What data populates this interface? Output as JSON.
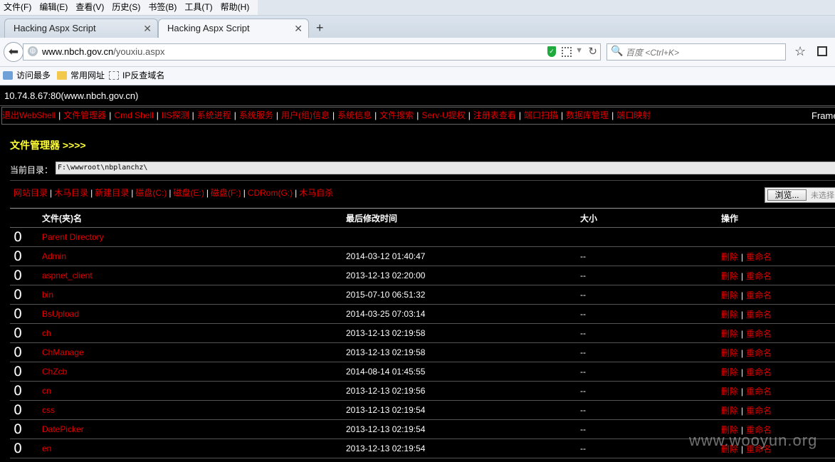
{
  "menu_bar": {
    "items": [
      "文件(F)",
      "编辑(E)",
      "查看(V)",
      "历史(S)",
      "书签(B)",
      "工具(T)",
      "帮助(H)"
    ]
  },
  "tabs": [
    {
      "label": "Hacking Aspx Script",
      "active": false
    },
    {
      "label": "Hacking Aspx Script",
      "active": true
    }
  ],
  "new_tab_label": "+",
  "nav": {
    "url_domain": "www.nbch.gov.cn",
    "url_path": "/youxiu.aspx",
    "search_placeholder": "百度 <Ctrl+K>"
  },
  "bookmarks": [
    "访问最多",
    "常用网址",
    "IP反查域名"
  ],
  "page": {
    "host": "10.74.8.67:80(www.nbch.gov.cn)",
    "top_menu": [
      "退出WebShell",
      "文件管理器",
      "Cmd Shell",
      "IIS探测",
      "系统进程",
      "系统服务",
      "用户(组)信息",
      "系统信息",
      "文件搜索",
      "Serv-U提权",
      "注册表查看",
      "端口扫描",
      "数据库管理",
      "端口映射"
    ],
    "frame_label": "Frame",
    "title": "文件管理器 >>>>",
    "current_dir_label": "当前目录：",
    "current_dir": "F:\\wwwroot\\nbplanchz\\",
    "dir_links": [
      "网站目录",
      "木马目录",
      "新建目录",
      "磁盘(C:)",
      "磁盘(E:)",
      "磁盘(F:)",
      "CDRom(G:)",
      "木马自杀"
    ],
    "browse_button": "浏览...",
    "no_file_text": "未选择",
    "table": {
      "headers": [
        "文件(夹)名",
        "最后修改时间",
        "大小",
        "操作"
      ],
      "rows": [
        {
          "icon": "0",
          "name": "Parent Directory",
          "modified": "",
          "size": "",
          "delete": "",
          "rename": ""
        },
        {
          "icon": "0",
          "name": "Admin",
          "modified": "2014-03-12 01:40:47",
          "size": "--",
          "delete": "删除",
          "rename": "重命名"
        },
        {
          "icon": "0",
          "name": "aspnet_client",
          "modified": "2013-12-13 02:20:00",
          "size": "--",
          "delete": "删除",
          "rename": "重命名"
        },
        {
          "icon": "0",
          "name": "bin",
          "modified": "2015-07-10 06:51:32",
          "size": "--",
          "delete": "删除",
          "rename": "重命名"
        },
        {
          "icon": "0",
          "name": "BsUpload",
          "modified": "2014-03-25 07:03:14",
          "size": "--",
          "delete": "删除",
          "rename": "重命名"
        },
        {
          "icon": "0",
          "name": "ch",
          "modified": "2013-12-13 02:19:58",
          "size": "--",
          "delete": "删除",
          "rename": "重命名"
        },
        {
          "icon": "0",
          "name": "ChManage",
          "modified": "2013-12-13 02:19:58",
          "size": "--",
          "delete": "删除",
          "rename": "重命名"
        },
        {
          "icon": "0",
          "name": "ChZcb",
          "modified": "2014-08-14 01:45:55",
          "size": "--",
          "delete": "删除",
          "rename": "重命名"
        },
        {
          "icon": "0",
          "name": "cn",
          "modified": "2013-12-13 02:19:56",
          "size": "--",
          "delete": "删除",
          "rename": "重命名"
        },
        {
          "icon": "0",
          "name": "css",
          "modified": "2013-12-13 02:19:54",
          "size": "--",
          "delete": "删除",
          "rename": "重命名"
        },
        {
          "icon": "0",
          "name": "DatePicker",
          "modified": "2013-12-13 02:19:54",
          "size": "--",
          "delete": "删除",
          "rename": "重命名"
        },
        {
          "icon": "0",
          "name": "en",
          "modified": "2013-12-13 02:19:54",
          "size": "--",
          "delete": "删除",
          "rename": "重命名"
        }
      ]
    }
  },
  "watermark": "www.wooyun.org",
  "colors": {
    "link_red": "#e20000",
    "title_yellow": "#ffff33",
    "page_bg": "#000000"
  }
}
